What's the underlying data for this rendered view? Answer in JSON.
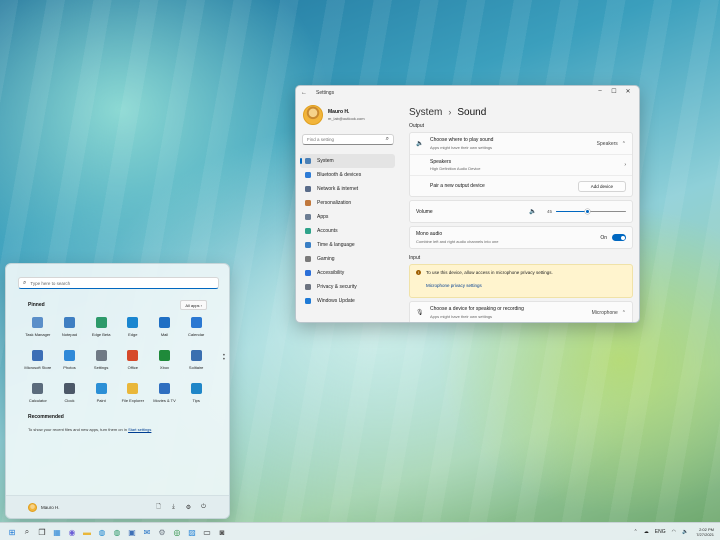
{
  "settings": {
    "window_title": "Settings",
    "profile": {
      "name": "Mauro H.",
      "email": "m_lab@outlook.com"
    },
    "find_placeholder": "Find a setting",
    "nav": [
      {
        "label": "System",
        "icon": "system-icon",
        "color": "#4a7fb5",
        "active": true
      },
      {
        "label": "Bluetooth & devices",
        "icon": "bluetooth-icon",
        "color": "#2e7cd6"
      },
      {
        "label": "Network & internet",
        "icon": "network-icon",
        "color": "#5a6c8a"
      },
      {
        "label": "Personalization",
        "icon": "brush-icon",
        "color": "#c0783d"
      },
      {
        "label": "Apps",
        "icon": "apps-icon",
        "color": "#6c7d93"
      },
      {
        "label": "Accounts",
        "icon": "accounts-icon",
        "color": "#2fa38a"
      },
      {
        "label": "Time & language",
        "icon": "globe-clock-icon",
        "color": "#3a7fc4"
      },
      {
        "label": "Gaming",
        "icon": "gaming-icon",
        "color": "#7a7a7a"
      },
      {
        "label": "Accessibility",
        "icon": "accessibility-icon",
        "color": "#2b6fd8"
      },
      {
        "label": "Privacy & security",
        "icon": "shield-icon",
        "color": "#6c7380"
      },
      {
        "label": "Windows Update",
        "icon": "update-icon",
        "color": "#1f7ad6"
      }
    ],
    "breadcrumb": {
      "parent": "System",
      "separator": "›",
      "current": "Sound"
    },
    "output_label": "Output",
    "choose_output": {
      "title": "Choose where to play sound",
      "sub": "Apps might have their own settings",
      "value": "Speakers"
    },
    "speakers": {
      "title": "Speakers",
      "sub": "High Definition Audio Device"
    },
    "pair_device": {
      "title": "Pair a new output device",
      "button": "Add device"
    },
    "volume": {
      "label": "Volume",
      "value": "45",
      "level": 0.45
    },
    "mono_audio": {
      "title": "Mono audio",
      "sub": "Combine left and right audio channels into one",
      "state": "On"
    },
    "input_label": "Input",
    "mic_warning": {
      "text": "To use this device, allow access in microphone privacy settings.",
      "link": "Microphone privacy settings"
    },
    "choose_input": {
      "title": "Choose a device for speaking or recording",
      "sub": "Apps might have their own settings",
      "value": "Microphone"
    }
  },
  "start_menu": {
    "search_placeholder": "Type here to search",
    "pinned_label": "Pinned",
    "all_apps_label": "All apps",
    "apps": [
      {
        "name": "Task Manager",
        "icon": "task-manager-icon",
        "color": "#5b8fc9"
      },
      {
        "name": "Notepad",
        "icon": "notepad-icon",
        "color": "#3f7fc2"
      },
      {
        "name": "Edge Beta",
        "icon": "edge-beta-icon",
        "color": "#2d9a6a"
      },
      {
        "name": "Edge",
        "icon": "edge-icon",
        "color": "#1a86d0"
      },
      {
        "name": "Mail",
        "icon": "mail-icon",
        "color": "#1f6fc4"
      },
      {
        "name": "Calendar",
        "icon": "calendar-icon",
        "color": "#2a78d2"
      },
      {
        "name": "Microsoft Store",
        "icon": "store-icon",
        "color": "#3d6fb6"
      },
      {
        "name": "Photos",
        "icon": "photos-icon",
        "color": "#2f89d8"
      },
      {
        "name": "Settings",
        "icon": "gear-icon",
        "color": "#707a85"
      },
      {
        "name": "Office",
        "icon": "office-icon",
        "color": "#d6492a"
      },
      {
        "name": "Xbox",
        "icon": "xbox-icon",
        "color": "#1f8a3a"
      },
      {
        "name": "Solitaire",
        "icon": "solitaire-icon",
        "color": "#3a6fb0"
      },
      {
        "name": "Calculator",
        "icon": "calculator-icon",
        "color": "#5b6b7c"
      },
      {
        "name": "Clock",
        "icon": "clock-icon",
        "color": "#4c5868"
      },
      {
        "name": "Paint",
        "icon": "paint-icon",
        "color": "#2b8fd6"
      },
      {
        "name": "File Explorer",
        "icon": "folder-icon",
        "color": "#e9b73a"
      },
      {
        "name": "Movies & TV",
        "icon": "movies-icon",
        "color": "#2f6fc0"
      },
      {
        "name": "Tips",
        "icon": "tips-icon",
        "color": "#1f86c8"
      }
    ],
    "recommended_label": "Recommended",
    "recommended_text": "To show your recent files and new apps, turn them on in ",
    "recommended_link": "Start settings",
    "user_name": "Mauro H."
  },
  "taskbar": {
    "icons": [
      "windows-logo-icon",
      "search-icon",
      "task-view-icon",
      "widgets-icon",
      "chat-icon",
      "file-explorer-icon",
      "edge-icon",
      "edge-beta-icon",
      "store-icon",
      "mail-icon",
      "settings-icon",
      "xbox-icon",
      "photos-icon",
      "terminal-icon",
      "camera-icon"
    ],
    "tray_lang": "ENG",
    "time": "2:02 PM",
    "date": "7/27/2021"
  }
}
